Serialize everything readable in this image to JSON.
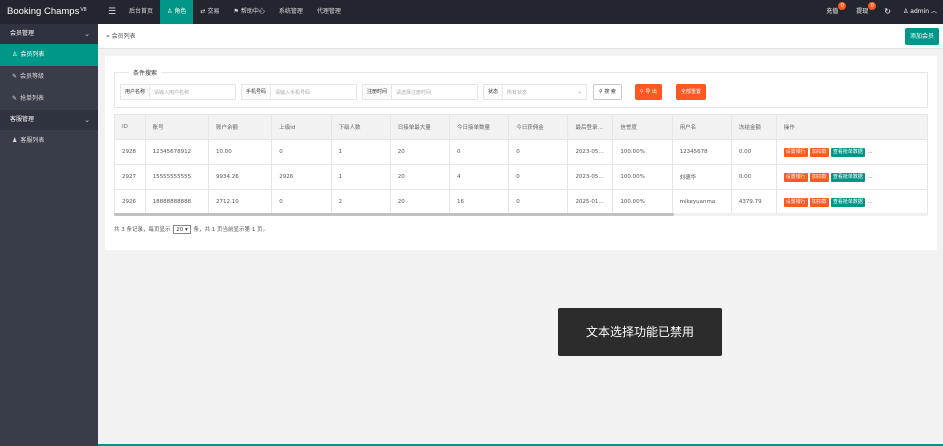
{
  "app": {
    "logo": "Booking Champs",
    "version": "V8"
  },
  "topnav": [
    {
      "label": "后台首页",
      "icon": ""
    },
    {
      "label": "角色",
      "icon": "user-icon",
      "glyph": "♙",
      "active": true
    },
    {
      "label": "交易",
      "icon": "exchange-icon",
      "glyph": "⇄"
    },
    {
      "label": "帮助中心",
      "icon": "flag-icon",
      "glyph": "⚑"
    },
    {
      "label": "系统管理",
      "icon": ""
    },
    {
      "label": "代理管理",
      "icon": ""
    }
  ],
  "topright": {
    "recharge": {
      "label": "充值",
      "badge": "0"
    },
    "withdraw": {
      "label": "提现",
      "badge": "0"
    },
    "refresh_glyph": "↻",
    "user": "admin"
  },
  "sidebar": [
    {
      "type": "group",
      "label": "会员管理"
    },
    {
      "type": "item",
      "label": "会员列表",
      "glyph": "♙",
      "icon": "user-icon",
      "active": true
    },
    {
      "type": "item",
      "label": "会员等级",
      "glyph": "✎",
      "icon": "link-icon"
    },
    {
      "type": "item",
      "label": "抢单列表",
      "glyph": "✎",
      "icon": "link-icon"
    },
    {
      "type": "group",
      "label": "客服管理"
    },
    {
      "type": "item",
      "label": "客服列表",
      "glyph": "♟",
      "icon": "users-icon"
    }
  ],
  "breadcrumb": "会员列表",
  "add_button": "添加会员",
  "search": {
    "legend": "条件搜索",
    "username": {
      "label": "用户名称",
      "placeholder": "请输入用户名称"
    },
    "phone": {
      "label": "手机号码",
      "placeholder": "请输入手机号码"
    },
    "regtime": {
      "label": "注册时间",
      "placeholder": "请选择注册时间"
    },
    "status": {
      "label": "状态",
      "placeholder": "所有状态"
    },
    "search_btn": "搜 索",
    "export_btn": "导 出",
    "reset_btn": "全部重置"
  },
  "table": {
    "headers": [
      "ID",
      "账号",
      "账户余额",
      "上级id",
      "下级人数",
      "日接单最大量",
      "今日接单数量",
      "今日获佣金",
      "最后登录时间",
      "信誉度",
      "用户名",
      "冻结金额",
      "操作"
    ],
    "rows": [
      [
        "2928",
        "12345678912",
        "10.00",
        "0",
        "1",
        "20",
        "0",
        "0",
        "2023-05-0...",
        "100.00%",
        "12345678",
        "0.00"
      ],
      [
        "2927",
        "15555555555",
        "9934.26",
        "2926",
        "1",
        "20",
        "4",
        "0",
        "2023-05-0...",
        "100.00%",
        "刘德华",
        "0.00"
      ],
      [
        "2926",
        "18888888888",
        "2712.10",
        "0",
        "2",
        "20",
        "16",
        "0",
        "2025-01-2...",
        "100.00%",
        "mikeyuanma",
        "4379.79"
      ]
    ],
    "actions": [
      "设置银行",
      "加扣款",
      "查看抢单数据",
      "..."
    ]
  },
  "pager": {
    "prefix": "共 3 条记录，每页显示",
    "page_size": "20",
    "suffix": "条，共 1 页当前显示第 1 页。"
  },
  "toast": "文本选择功能已禁用"
}
